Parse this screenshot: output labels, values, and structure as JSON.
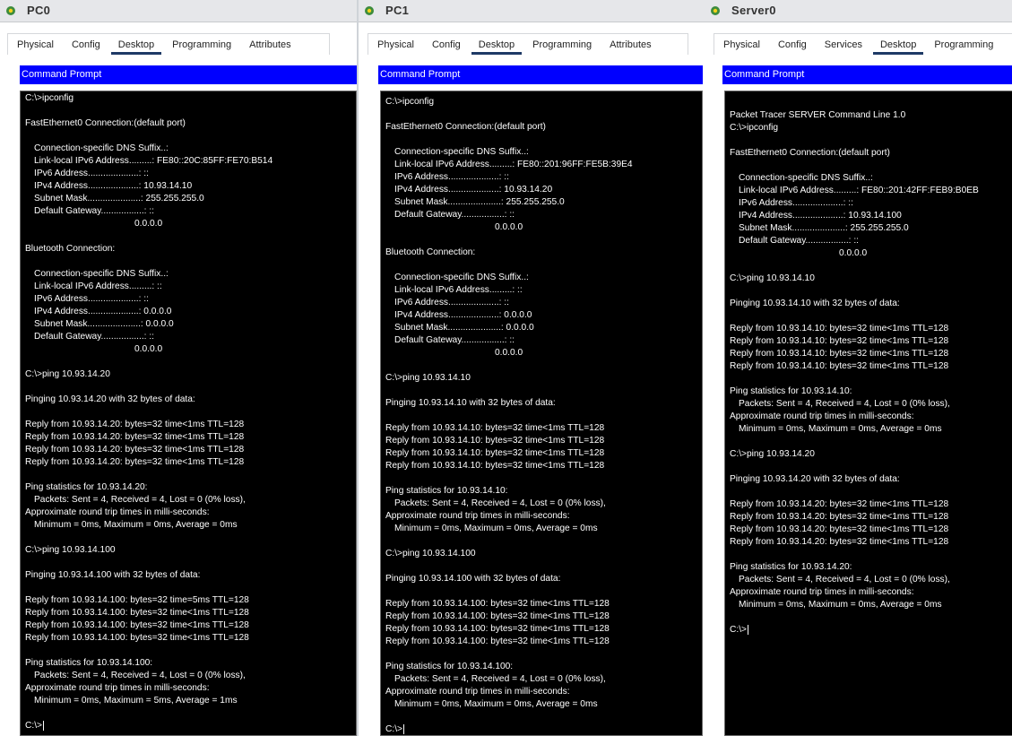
{
  "windows": [
    {
      "id": "pc0",
      "title": "PC0",
      "tabs": [
        "Physical",
        "Config",
        "Desktop",
        "Programming",
        "Attributes"
      ],
      "active_tab": "Desktop",
      "panel_title": "Command Prompt",
      "lines": [
        {
          "t": "C:\\>ipconfig"
        },
        {
          "t": ""
        },
        {
          "t": "FastEthernet0 Connection:(default port)"
        },
        {
          "t": ""
        },
        {
          "t": "Connection-specific DNS Suffix..:",
          "i": 1
        },
        {
          "t": "Link-local IPv6 Address.........: FE80::20C:85FF:FE70:B514",
          "i": 1
        },
        {
          "t": "IPv6 Address....................: ::",
          "i": 1
        },
        {
          "t": "IPv4 Address....................: 10.93.14.10",
          "i": 1
        },
        {
          "t": "Subnet Mask.....................: 255.255.255.0",
          "i": 1
        },
        {
          "t": "Default Gateway.................: ::",
          "i": 1
        },
        {
          "t": "0.0.0.0",
          "c": 1
        },
        {
          "t": ""
        },
        {
          "t": "Bluetooth Connection:"
        },
        {
          "t": ""
        },
        {
          "t": "Connection-specific DNS Suffix..:",
          "i": 1
        },
        {
          "t": "Link-local IPv6 Address.........: ::",
          "i": 1
        },
        {
          "t": "IPv6 Address....................: ::",
          "i": 1
        },
        {
          "t": "IPv4 Address....................: 0.0.0.0",
          "i": 1
        },
        {
          "t": "Subnet Mask.....................: 0.0.0.0",
          "i": 1
        },
        {
          "t": "Default Gateway.................: ::",
          "i": 1
        },
        {
          "t": "0.0.0.0",
          "c": 1
        },
        {
          "t": ""
        },
        {
          "t": "C:\\>ping 10.93.14.20"
        },
        {
          "t": ""
        },
        {
          "t": "Pinging 10.93.14.20 with 32 bytes of data:"
        },
        {
          "t": ""
        },
        {
          "t": "Reply from 10.93.14.20: bytes=32 time<1ms TTL=128"
        },
        {
          "t": "Reply from 10.93.14.20: bytes=32 time<1ms TTL=128"
        },
        {
          "t": "Reply from 10.93.14.20: bytes=32 time<1ms TTL=128"
        },
        {
          "t": "Reply from 10.93.14.20: bytes=32 time<1ms TTL=128"
        },
        {
          "t": ""
        },
        {
          "t": "Ping statistics for 10.93.14.20:"
        },
        {
          "t": "Packets: Sent = 4, Received = 4, Lost = 0 (0% loss),",
          "i": 1
        },
        {
          "t": "Approximate round trip times in milli-seconds:"
        },
        {
          "t": "Minimum = 0ms, Maximum = 0ms, Average = 0ms",
          "i": 1
        },
        {
          "t": ""
        },
        {
          "t": "C:\\>ping 10.93.14.100"
        },
        {
          "t": ""
        },
        {
          "t": "Pinging 10.93.14.100 with 32 bytes of data:"
        },
        {
          "t": ""
        },
        {
          "t": "Reply from 10.93.14.100: bytes=32 time=5ms TTL=128"
        },
        {
          "t": "Reply from 10.93.14.100: bytes=32 time<1ms TTL=128"
        },
        {
          "t": "Reply from 10.93.14.100: bytes=32 time<1ms TTL=128"
        },
        {
          "t": "Reply from 10.93.14.100: bytes=32 time<1ms TTL=128"
        },
        {
          "t": ""
        },
        {
          "t": "Ping statistics for 10.93.14.100:"
        },
        {
          "t": "Packets: Sent = 4, Received = 4, Lost = 0 (0% loss),",
          "i": 1
        },
        {
          "t": "Approximate round trip times in milli-seconds:"
        },
        {
          "t": "Minimum = 0ms, Maximum = 5ms, Average = 1ms",
          "i": 1
        },
        {
          "t": ""
        },
        {
          "t": "C:\\>",
          "cur": 1
        }
      ]
    },
    {
      "id": "pc1",
      "title": "PC1",
      "tabs": [
        "Physical",
        "Config",
        "Desktop",
        "Programming",
        "Attributes"
      ],
      "active_tab": "Desktop",
      "panel_title": "Command Prompt",
      "lines": [
        {
          "t": "C:\\>ipconfig"
        },
        {
          "t": ""
        },
        {
          "t": "FastEthernet0 Connection:(default port)"
        },
        {
          "t": ""
        },
        {
          "t": "Connection-specific DNS Suffix..:",
          "i": 1
        },
        {
          "t": "Link-local IPv6 Address.........: FE80::201:96FF:FE5B:39E4",
          "i": 1
        },
        {
          "t": "IPv6 Address....................: ::",
          "i": 1
        },
        {
          "t": "IPv4 Address....................: 10.93.14.20",
          "i": 1
        },
        {
          "t": "Subnet Mask.....................: 255.255.255.0",
          "i": 1
        },
        {
          "t": "Default Gateway.................: ::",
          "i": 1
        },
        {
          "t": "0.0.0.0",
          "c": 1
        },
        {
          "t": ""
        },
        {
          "t": "Bluetooth Connection:"
        },
        {
          "t": ""
        },
        {
          "t": "Connection-specific DNS Suffix..:",
          "i": 1
        },
        {
          "t": "Link-local IPv6 Address.........: ::",
          "i": 1
        },
        {
          "t": "IPv6 Address....................: ::",
          "i": 1
        },
        {
          "t": "IPv4 Address....................: 0.0.0.0",
          "i": 1
        },
        {
          "t": "Subnet Mask.....................: 0.0.0.0",
          "i": 1
        },
        {
          "t": "Default Gateway.................: ::",
          "i": 1
        },
        {
          "t": "0.0.0.0",
          "c": 1
        },
        {
          "t": ""
        },
        {
          "t": "C:\\>ping 10.93.14.10"
        },
        {
          "t": ""
        },
        {
          "t": "Pinging 10.93.14.10 with 32 bytes of data:"
        },
        {
          "t": ""
        },
        {
          "t": "Reply from 10.93.14.10: bytes=32 time<1ms TTL=128"
        },
        {
          "t": "Reply from 10.93.14.10: bytes=32 time<1ms TTL=128"
        },
        {
          "t": "Reply from 10.93.14.10: bytes=32 time<1ms TTL=128"
        },
        {
          "t": "Reply from 10.93.14.10: bytes=32 time<1ms TTL=128"
        },
        {
          "t": ""
        },
        {
          "t": "Ping statistics for 10.93.14.10:"
        },
        {
          "t": "Packets: Sent = 4, Received = 4, Lost = 0 (0% loss),",
          "i": 1
        },
        {
          "t": "Approximate round trip times in milli-seconds:"
        },
        {
          "t": "Minimum = 0ms, Maximum = 0ms, Average = 0ms",
          "i": 1
        },
        {
          "t": ""
        },
        {
          "t": "C:\\>ping 10.93.14.100"
        },
        {
          "t": ""
        },
        {
          "t": "Pinging 10.93.14.100 with 32 bytes of data:"
        },
        {
          "t": ""
        },
        {
          "t": "Reply from 10.93.14.100: bytes=32 time<1ms TTL=128"
        },
        {
          "t": "Reply from 10.93.14.100: bytes=32 time<1ms TTL=128"
        },
        {
          "t": "Reply from 10.93.14.100: bytes=32 time<1ms TTL=128"
        },
        {
          "t": "Reply from 10.93.14.100: bytes=32 time<1ms TTL=128"
        },
        {
          "t": ""
        },
        {
          "t": "Ping statistics for 10.93.14.100:"
        },
        {
          "t": "Packets: Sent = 4, Received = 4, Lost = 0 (0% loss),",
          "i": 1
        },
        {
          "t": "Approximate round trip times in milli-seconds:"
        },
        {
          "t": "Minimum = 0ms, Maximum = 0ms, Average = 0ms",
          "i": 1
        },
        {
          "t": ""
        },
        {
          "t": "C:\\>",
          "cur": 1
        }
      ]
    },
    {
      "id": "server0",
      "title": "Server0",
      "tabs": [
        "Physical",
        "Config",
        "Services",
        "Desktop",
        "Programming"
      ],
      "active_tab": "Desktop",
      "panel_title": "Command Prompt",
      "lines": [
        {
          "t": ""
        },
        {
          "t": "Packet Tracer SERVER Command Line 1.0"
        },
        {
          "t": "C:\\>ipconfig"
        },
        {
          "t": ""
        },
        {
          "t": "FastEthernet0 Connection:(default port)"
        },
        {
          "t": ""
        },
        {
          "t": "Connection-specific DNS Suffix..:",
          "i": 1
        },
        {
          "t": "Link-local IPv6 Address.........: FE80::201:42FF:FEB9:B0EB",
          "i": 1
        },
        {
          "t": "IPv6 Address....................: ::",
          "i": 1
        },
        {
          "t": "IPv4 Address....................: 10.93.14.100",
          "i": 1
        },
        {
          "t": "Subnet Mask.....................: 255.255.255.0",
          "i": 1
        },
        {
          "t": "Default Gateway.................: ::",
          "i": 1
        },
        {
          "t": "0.0.0.0",
          "c": 1
        },
        {
          "t": ""
        },
        {
          "t": "C:\\>ping 10.93.14.10"
        },
        {
          "t": ""
        },
        {
          "t": "Pinging 10.93.14.10 with 32 bytes of data:"
        },
        {
          "t": ""
        },
        {
          "t": "Reply from 10.93.14.10: bytes=32 time<1ms TTL=128"
        },
        {
          "t": "Reply from 10.93.14.10: bytes=32 time<1ms TTL=128"
        },
        {
          "t": "Reply from 10.93.14.10: bytes=32 time<1ms TTL=128"
        },
        {
          "t": "Reply from 10.93.14.10: bytes=32 time<1ms TTL=128"
        },
        {
          "t": ""
        },
        {
          "t": "Ping statistics for 10.93.14.10:"
        },
        {
          "t": "Packets: Sent = 4, Received = 4, Lost = 0 (0% loss),",
          "i": 1
        },
        {
          "t": "Approximate round trip times in milli-seconds:"
        },
        {
          "t": "Minimum = 0ms, Maximum = 0ms, Average = 0ms",
          "i": 1
        },
        {
          "t": ""
        },
        {
          "t": "C:\\>ping 10.93.14.20"
        },
        {
          "t": ""
        },
        {
          "t": "Pinging 10.93.14.20 with 32 bytes of data:"
        },
        {
          "t": ""
        },
        {
          "t": "Reply from 10.93.14.20: bytes=32 time<1ms TTL=128"
        },
        {
          "t": "Reply from 10.93.14.20: bytes=32 time<1ms TTL=128"
        },
        {
          "t": "Reply from 10.93.14.20: bytes=32 time<1ms TTL=128"
        },
        {
          "t": "Reply from 10.93.14.20: bytes=32 time<1ms TTL=128"
        },
        {
          "t": ""
        },
        {
          "t": "Ping statistics for 10.93.14.20:"
        },
        {
          "t": "Packets: Sent = 4, Received = 4, Lost = 0 (0% loss),",
          "i": 1
        },
        {
          "t": "Approximate round trip times in milli-seconds:"
        },
        {
          "t": "Minimum = 0ms, Maximum = 0ms, Average = 0ms",
          "i": 1
        },
        {
          "t": ""
        },
        {
          "t": "C:\\>",
          "cur": 1
        }
      ]
    }
  ]
}
